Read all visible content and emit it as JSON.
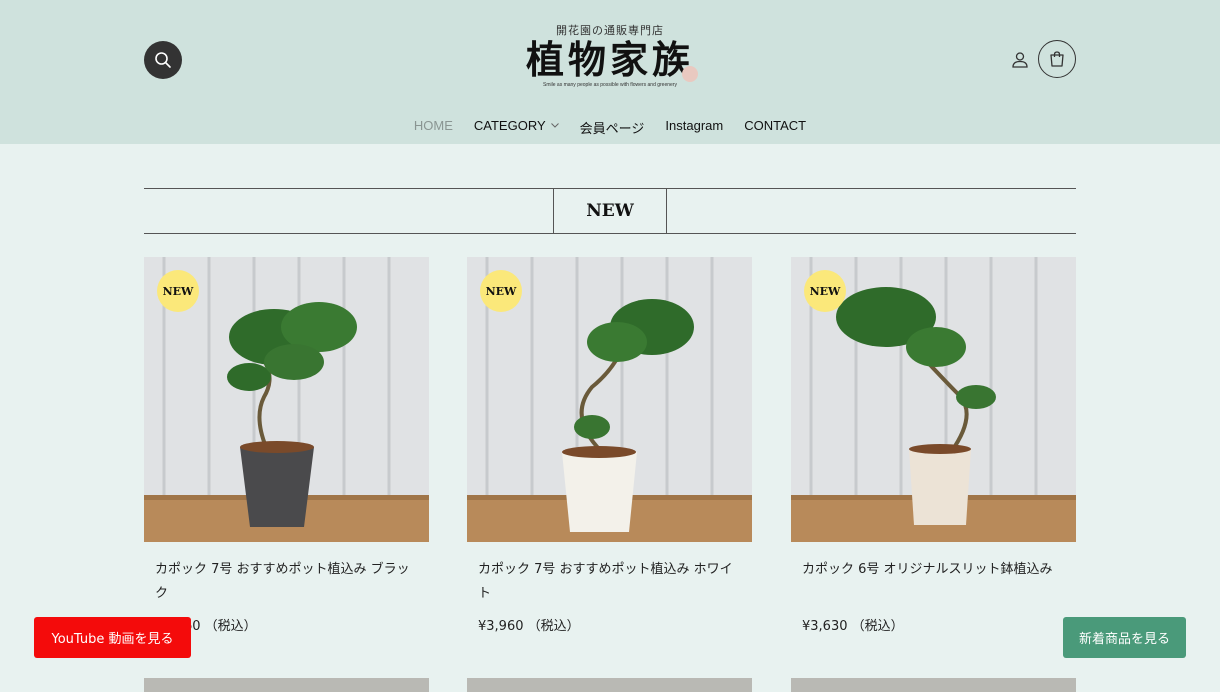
{
  "header": {
    "logo_subtitle": "開花園の通販専門店",
    "logo_title": "植物家族",
    "logo_tagline": "Smile as many people as possible with flowers and greenery",
    "search_icon": "search-icon",
    "account_icon": "user-icon",
    "cart_icon": "cart-icon"
  },
  "nav": {
    "items": [
      {
        "label": "HOME",
        "active": true
      },
      {
        "label": "CATEGORY",
        "has_dropdown": true
      },
      {
        "label": "会員ページ"
      },
      {
        "label": "Instagram"
      },
      {
        "label": "CONTACT"
      }
    ]
  },
  "section": {
    "title": "NEW"
  },
  "products": [
    {
      "badge": "NEW",
      "name": "カポック 7号 おすすめポット植込み ブラック",
      "price": "¥3,960 （税込）",
      "pot_color": "#4a4a4c"
    },
    {
      "badge": "NEW",
      "name": "カポック 7号 おすすめポット植込み ホワイト",
      "price": "¥3,960 （税込）",
      "pot_color": "#f3f1ea"
    },
    {
      "badge": "NEW",
      "name": "カポック 6号 オリジナルスリット鉢植込み",
      "price": "¥3,630 （税込）",
      "pot_color": "#ece3d6"
    }
  ],
  "floating": {
    "youtube_label": "YouTube 動画を見る",
    "new_items_label": "新着商品を見る"
  },
  "colors": {
    "header_bg": "#cfe2dd",
    "page_bg": "#e8f2f0",
    "badge": "#fbe87a",
    "youtube_button": "#f40b0b",
    "new_items_button": "#4a9a7a"
  }
}
